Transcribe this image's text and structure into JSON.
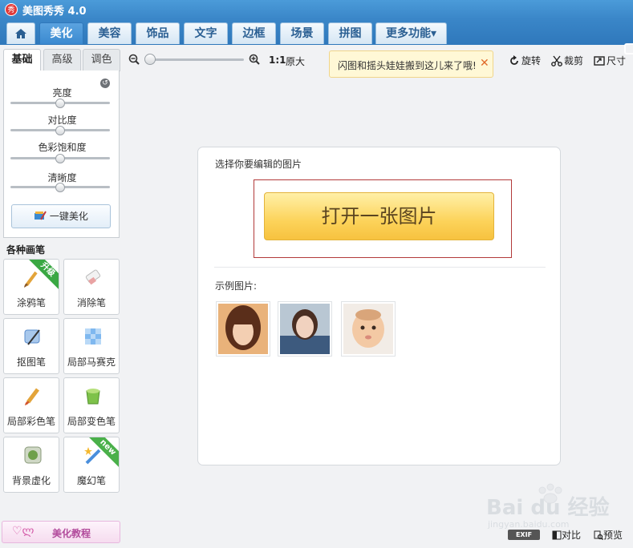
{
  "app": {
    "title": "美图秀秀 4.0",
    "logo_char": "秀"
  },
  "tabs": [
    {
      "label": "",
      "icon": "home-icon"
    },
    {
      "label": "美化",
      "active": true
    },
    {
      "label": "美容"
    },
    {
      "label": "饰品"
    },
    {
      "label": "文字"
    },
    {
      "label": "边框"
    },
    {
      "label": "场景"
    },
    {
      "label": "拼图"
    },
    {
      "label": "更多功能▾"
    }
  ],
  "left_panel": {
    "subtabs": [
      "基础",
      "高级",
      "调色"
    ],
    "sliders": [
      {
        "label": "亮度",
        "value": 0.5
      },
      {
        "label": "对比度",
        "value": 0.5
      },
      {
        "label": "色彩饱和度",
        "value": 0.5
      },
      {
        "label": "清晰度",
        "value": 0.5
      }
    ],
    "one_key_label": "一键美化",
    "brush_heading": "各种画笔",
    "tools": [
      {
        "label": "涂鸦笔",
        "icon": "brush-icon",
        "ribbon": "升级"
      },
      {
        "label": "消除笔",
        "icon": "eraser-icon"
      },
      {
        "label": "抠图笔",
        "icon": "cutout-pen-icon"
      },
      {
        "label": "局部马赛克",
        "icon": "mosaic-icon"
      },
      {
        "label": "局部彩色笔",
        "icon": "color-brush-icon"
      },
      {
        "label": "局部变色笔",
        "icon": "paint-bucket-icon"
      },
      {
        "label": "背景虚化",
        "icon": "blur-background-icon"
      },
      {
        "label": "魔幻笔",
        "icon": "magic-pen-icon",
        "ribbon": "new"
      }
    ],
    "tutorial_label": "美化教程"
  },
  "toolbar": {
    "ratio_label": "1:1",
    "original_label": "原大",
    "zoom_value": 0.0,
    "notice_text": "闪图和摇头娃娃搬到这儿来了哦!",
    "rotate_label": "旋转",
    "crop_label": "裁剪",
    "size_label": "尺寸"
  },
  "card": {
    "select_label": "选择你要编辑的图片",
    "open_button_label": "打开一张图片",
    "sample_label": "示例图片:"
  },
  "bottom": {
    "exif_label": "EXIF",
    "compare_label": "对比",
    "preview_label": "预览"
  },
  "watermark": {
    "text": "Bai du 经验",
    "subtext": "jingyan.baidu.com"
  },
  "colors": {
    "accent": "#3a86c8",
    "open_button": "#fcd35a",
    "frame": "#b23a3a"
  }
}
